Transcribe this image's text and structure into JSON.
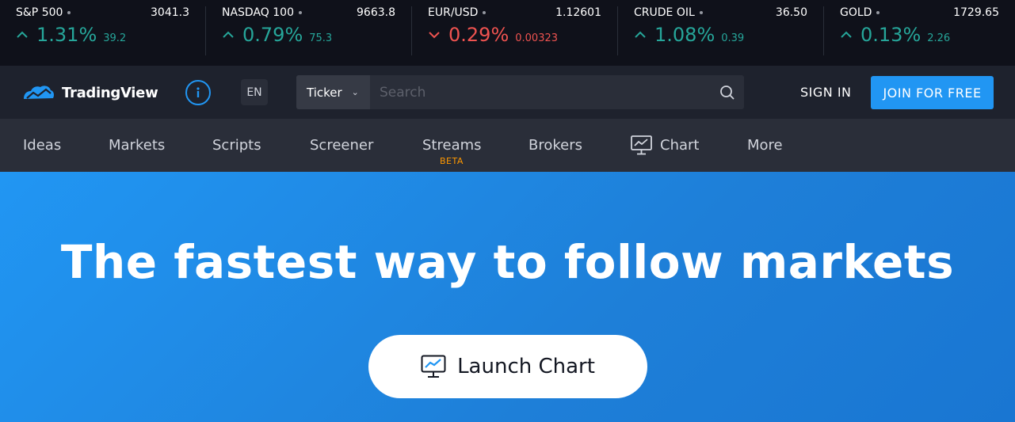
{
  "tickers": [
    {
      "name": "S&P 500",
      "price": "3041.3",
      "pct": "1.31%",
      "chg": "39.2",
      "dir": "up"
    },
    {
      "name": "NASDAQ 100",
      "price": "9663.8",
      "pct": "0.79%",
      "chg": "75.3",
      "dir": "up"
    },
    {
      "name": "EUR/USD",
      "price": "1.12601",
      "pct": "0.29%",
      "chg": "0.00323",
      "dir": "down"
    },
    {
      "name": "CRUDE OIL",
      "price": "36.50",
      "pct": "1.08%",
      "chg": "0.39",
      "dir": "up"
    },
    {
      "name": "GOLD",
      "price": "1729.65",
      "pct": "0.13%",
      "chg": "2.26",
      "dir": "up"
    }
  ],
  "header": {
    "logo_text": "TradingView",
    "lang": "EN",
    "ticker_select": "Ticker",
    "search_placeholder": "Search",
    "sign_in": "SIGN IN",
    "join": "JOIN FOR FREE"
  },
  "nav": {
    "ideas": "Ideas",
    "markets": "Markets",
    "scripts": "Scripts",
    "screener": "Screener",
    "streams": "Streams",
    "beta": "BETA",
    "brokers": "Brokers",
    "chart": "Chart",
    "more": "More"
  },
  "hero": {
    "title": "The fastest way to follow markets",
    "launch": "Launch Chart"
  },
  "colors": {
    "up": "#26a69a",
    "down": "#ef5350",
    "accent": "#2196f3",
    "beta": "#ff9800"
  }
}
